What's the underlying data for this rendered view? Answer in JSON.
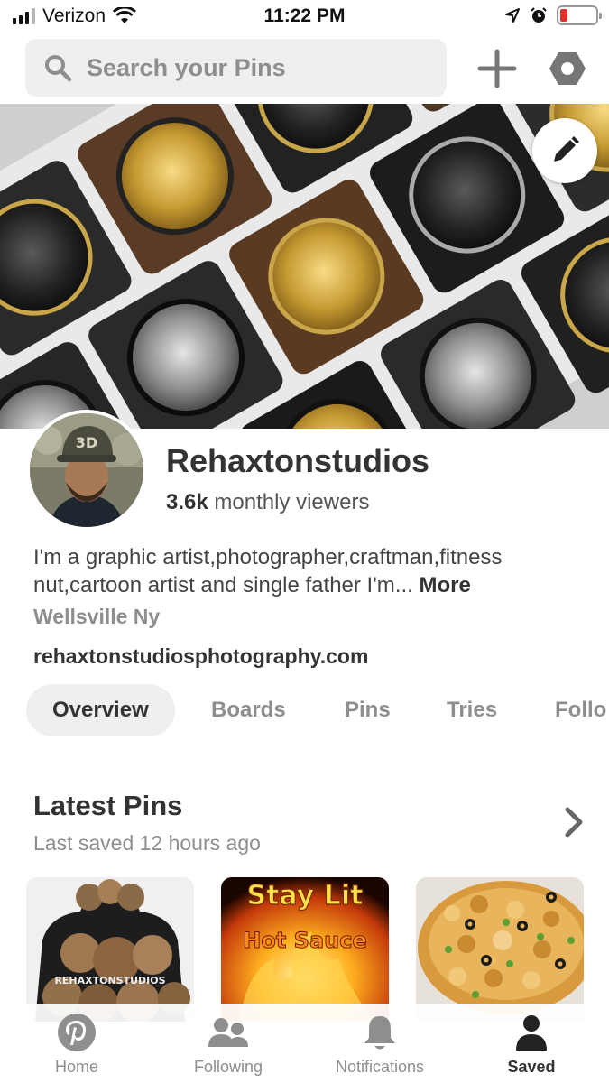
{
  "status_bar": {
    "carrier": "Verizon",
    "time": "11:22 PM"
  },
  "search": {
    "placeholder": "Search your Pins"
  },
  "profile": {
    "name": "Rehaxtonstudios",
    "viewers_count": "3.6k",
    "viewers_label": "monthly viewers",
    "bio": "I'm a graphic artist,photographer,craftman,fitness nut,cartoon artist and single father I'm...",
    "bio_more": "More",
    "location": "Wellsville Ny",
    "website": "rehaxtonstudiosphotography.com"
  },
  "tabs": [
    {
      "label": "Overview",
      "active": true
    },
    {
      "label": "Boards"
    },
    {
      "label": "Pins"
    },
    {
      "label": "Tries"
    },
    {
      "label": "Follo"
    }
  ],
  "latest": {
    "title": "Latest Pins",
    "subtitle": "Last saved 12 hours ago",
    "pins": [
      {
        "name": "hoodie-pin",
        "caption": "REHAXTONSTUDIOS"
      },
      {
        "name": "hot-sauce-pin",
        "caption_line1": "Stay Lit",
        "caption_line2": "Hot Sauce"
      },
      {
        "name": "casserole-pin"
      }
    ]
  },
  "nav": [
    {
      "label": "Home",
      "icon": "pinterest-icon"
    },
    {
      "label": "Following",
      "icon": "people-icon"
    },
    {
      "label": "Notifications",
      "icon": "bell-icon"
    },
    {
      "label": "Saved",
      "icon": "person-icon",
      "active": true
    }
  ],
  "colors": {
    "accent": "#e60023",
    "battery_low": "#e0322a",
    "gray_text": "#8e8e8e"
  }
}
